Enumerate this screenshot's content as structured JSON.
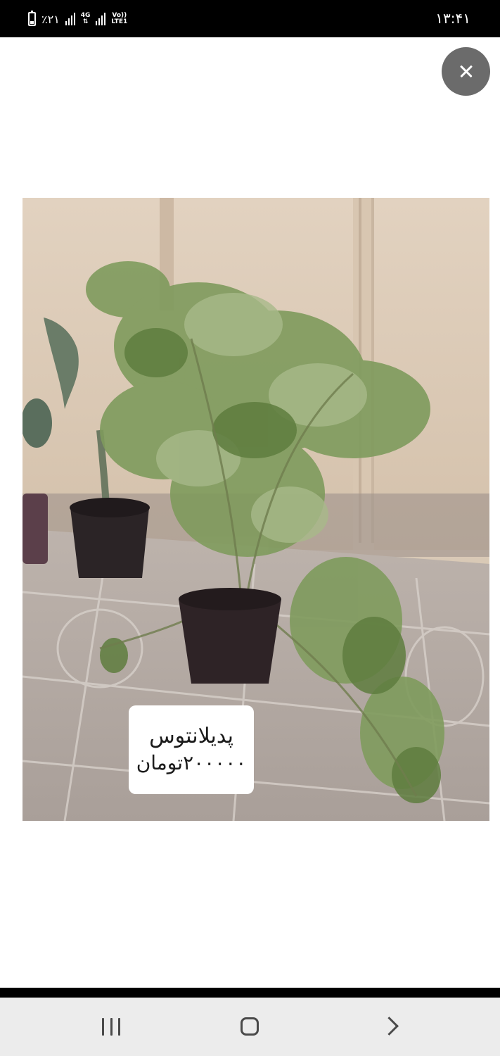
{
  "status_bar": {
    "battery_percent": "٪۲۱",
    "network_4g": "4G",
    "volte": "Vo))",
    "lte": "LTE1",
    "time": "۱۳:۴۱"
  },
  "viewer": {
    "close_icon": "close-icon"
  },
  "photo": {
    "label_line1": "پدیلانتوس",
    "label_line2": "۲۰۰۰۰۰تومان"
  },
  "nav_bar": {
    "recent_icon": "recent-apps-icon",
    "home_icon": "home-icon",
    "back_icon": "back-icon"
  }
}
